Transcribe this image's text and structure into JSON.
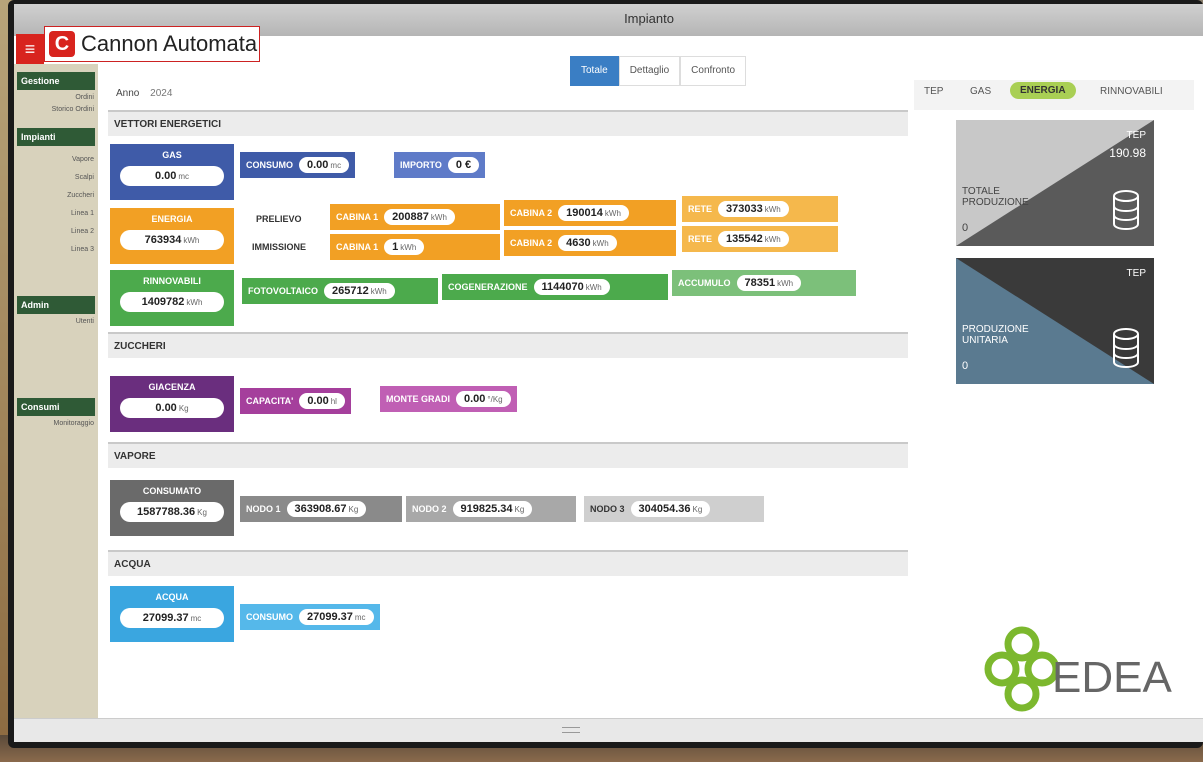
{
  "window": {
    "title": "Impianto"
  },
  "brand": {
    "logo_text": "Cannon Automata"
  },
  "sidebar": {
    "groups": [
      {
        "label": "Gestione",
        "items": [
          "Ordini",
          "Storico Ordini"
        ]
      },
      {
        "label": "Impianti",
        "items": [
          "Vapore",
          "Scalpi",
          "Zuccheri",
          "Linea 1",
          "Linea 2",
          "Linea 3"
        ]
      },
      {
        "label": "Admin",
        "items": [
          "Utenti"
        ]
      },
      {
        "label": "Consumi",
        "items": [
          "Monitoraggio"
        ]
      }
    ]
  },
  "filter": {
    "label": "Anno",
    "value": "2024"
  },
  "tabs": [
    "Totale",
    "Dettaglio",
    "Confronto"
  ],
  "sections": {
    "vettori": {
      "title": "VETTORI ENERGETICI",
      "gas": {
        "label": "GAS",
        "value": "0.00",
        "unit": "mc",
        "consumo_label": "CONSUMO",
        "consumo_value": "0.00",
        "consumo_unit": "mc",
        "importo_label": "IMPORTO",
        "importo_value": "0 €"
      },
      "energia": {
        "label": "ENERGIA",
        "value": "763934",
        "unit": "kWh",
        "prelievo_label": "PRELIEVO",
        "immissione_label": "IMMISSIONE",
        "prelievo": [
          {
            "label": "CABINA 1",
            "value": "200887",
            "unit": "kWh"
          },
          {
            "label": "CABINA 2",
            "value": "190014",
            "unit": "kWh"
          },
          {
            "label": "RETE",
            "value": "373033",
            "unit": "kWh"
          }
        ],
        "immissione": [
          {
            "label": "CABINA 1",
            "value": "1",
            "unit": "kWh"
          },
          {
            "label": "CABINA 2",
            "value": "4630",
            "unit": "kWh"
          },
          {
            "label": "RETE",
            "value": "135542",
            "unit": "kWh"
          }
        ]
      },
      "rinnovabili": {
        "label": "RINNOVABILI",
        "value": "1409782",
        "unit": "kWh",
        "items": [
          {
            "label": "FOTOVOLTAICO",
            "value": "265712",
            "unit": "kWh"
          },
          {
            "label": "COGENERAZIONE",
            "value": "1144070",
            "unit": "kWh"
          },
          {
            "label": "ACCUMULO",
            "value": "78351",
            "unit": "kWh"
          }
        ]
      }
    },
    "zuccheri": {
      "title": "ZUCCHERI",
      "giacenza": {
        "label": "GIACENZA",
        "value": "0.00",
        "unit": "Kg"
      },
      "items": [
        {
          "label": "CAPACITA'",
          "value": "0.00",
          "unit": "hl"
        },
        {
          "label": "MONTE GRADI",
          "value": "0.00",
          "unit": "°/Kg"
        }
      ]
    },
    "vapore": {
      "title": "VAPORE",
      "consumato": {
        "label": "CONSUMATO",
        "value": "1587788.36",
        "unit": "Kg"
      },
      "items": [
        {
          "label": "NODO 1",
          "value": "363908.67",
          "unit": "Kg"
        },
        {
          "label": "NODO 2",
          "value": "919825.34",
          "unit": "Kg"
        },
        {
          "label": "NODO 3",
          "value": "304054.36",
          "unit": "Kg"
        }
      ]
    },
    "acqua": {
      "title": "ACQUA",
      "acqua": {
        "label": "ACQUA",
        "value": "27099.37",
        "unit": "mc"
      },
      "consumo": {
        "label": "CONSUMO",
        "value": "27099.37",
        "unit": "mc"
      }
    }
  },
  "right_panel": {
    "tabs": [
      "TEP",
      "GAS",
      "ENERGIA",
      "RINNOVABILI"
    ],
    "active_tab": "ENERGIA",
    "card1": {
      "unit": "TEP",
      "value": "190.98",
      "label": "TOTALE PRODUZIONE",
      "sub": "0"
    },
    "card2": {
      "unit": "TEP",
      "value": "",
      "label": "PRODUZIONE UNITARIA",
      "sub": "0"
    },
    "logo": "EDEA"
  },
  "colors": {
    "gas": "#3f5ba8",
    "energia": "#f2a024",
    "rinnovabili": "#4caa4c",
    "zuccheri": "#6a2e7e",
    "vapore": "#6a6a6a",
    "acqua": "#3aa6e0",
    "accent": "#a9cf54"
  }
}
